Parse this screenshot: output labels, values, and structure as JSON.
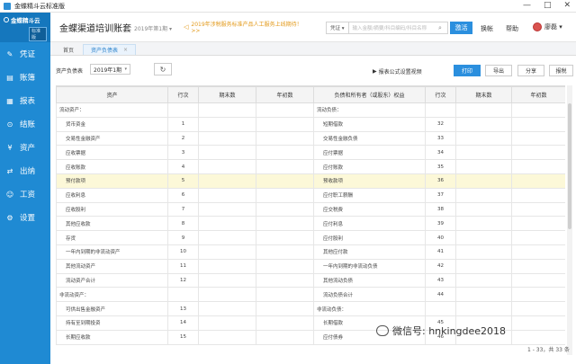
{
  "window": {
    "title": "金蝶精斗云标准版",
    "controls": [
      "—",
      "□",
      "✕"
    ]
  },
  "sidebar": {
    "logo_text": "金蝶精斗云",
    "logo_badge": "标准版",
    "items": [
      {
        "icon": "✎",
        "label": "凭证"
      },
      {
        "icon": "▤",
        "label": "账簿"
      },
      {
        "icon": "▦",
        "label": "报表"
      },
      {
        "icon": "⊙",
        "label": "结账"
      },
      {
        "icon": "¥",
        "label": "资产"
      },
      {
        "icon": "⇄",
        "label": "出纳"
      },
      {
        "icon": "☺",
        "label": "工资"
      },
      {
        "icon": "⚙",
        "label": "设置"
      }
    ]
  },
  "header": {
    "account_name": "金蝶渠道培训账套",
    "period": "2019年第1期 ▾",
    "notice": "2019年涉税服务标准产品人工服务上线期待！>>",
    "search_type": "凭证 ▾",
    "search_placeholder": "输入金额/摘要/科目编码/科目名称",
    "activate_label": "激活",
    "switch_label": "换帐",
    "help_label": "帮助",
    "user_name": "廖磊 ▾"
  },
  "tabs": [
    {
      "label": "首页"
    },
    {
      "label": "资产负债表",
      "close": "×"
    }
  ],
  "toolbar": {
    "report_label": "资产负债表",
    "period_value": "2019年1期",
    "period_caret": "▾",
    "refresh_icon": "↻",
    "video_icon": "▶",
    "video_label": "报表公式设置视频",
    "print_label": "打印",
    "export_label": "导出",
    "share_label": "分享",
    "report_label2": "报税"
  },
  "table": {
    "headers": [
      "资产",
      "行次",
      "期末数",
      "年初数",
      "负债和所有者（或股东）权益",
      "行次",
      "期末数",
      "年初数"
    ],
    "rows": [
      [
        "流动资产：",
        "",
        "",
        "",
        "流动负债：",
        "",
        "",
        ""
      ],
      [
        "货币资金",
        "1",
        "",
        "",
        "短期借款",
        "32",
        "",
        ""
      ],
      [
        "交易性金融资产",
        "2",
        "",
        "",
        "交易性金融负债",
        "33",
        "",
        ""
      ],
      [
        "应收票据",
        "3",
        "",
        "",
        "应付票据",
        "34",
        "",
        ""
      ],
      [
        "应收账款",
        "4",
        "",
        "",
        "应付账款",
        "35",
        "",
        ""
      ],
      [
        "预付款项",
        "5",
        "",
        "",
        "预收款项",
        "36",
        "",
        ""
      ],
      [
        "应收利息",
        "6",
        "",
        "",
        "应付职工薪酬",
        "37",
        "",
        ""
      ],
      [
        "应收股利",
        "7",
        "",
        "",
        "应交税费",
        "38",
        "",
        ""
      ],
      [
        "其他应收款",
        "8",
        "",
        "",
        "应付利息",
        "39",
        "",
        ""
      ],
      [
        "存货",
        "9",
        "",
        "",
        "应付股利",
        "40",
        "",
        ""
      ],
      [
        "一年内到期的非流动资产",
        "10",
        "",
        "",
        "其他应付款",
        "41",
        "",
        ""
      ],
      [
        "其他流动资产",
        "11",
        "",
        "",
        "一年内到期的非流动负债",
        "42",
        "",
        ""
      ],
      [
        "流动资产合计",
        "12",
        "",
        "",
        "其他流动负债",
        "43",
        "",
        ""
      ],
      [
        "非流动资产：",
        "",
        "",
        "",
        "流动负债合计",
        "44",
        "",
        ""
      ],
      [
        "可供出售金融资产",
        "13",
        "",
        "",
        "非流动负债：",
        "",
        "",
        ""
      ],
      [
        "持有至到期投资",
        "14",
        "",
        "",
        "长期借款",
        "45",
        "",
        ""
      ],
      [
        "长期应收款",
        "15",
        "",
        "",
        "应付债券",
        "46",
        "",
        ""
      ]
    ],
    "highlight_row": 5
  },
  "pager": "1 - 33，共 33 条",
  "watermark": "微信号: hnkingdee2018"
}
